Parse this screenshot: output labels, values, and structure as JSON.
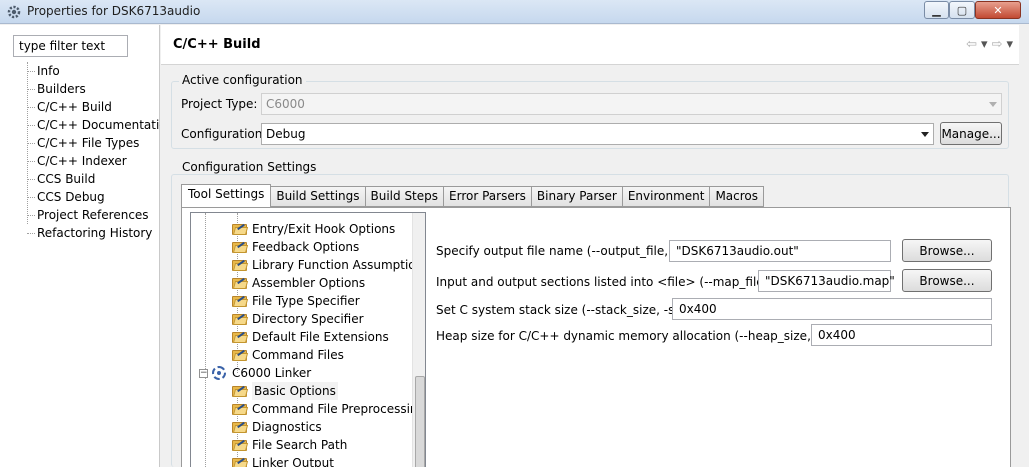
{
  "window": {
    "title": "Properties for DSK6713audio",
    "minimize_label": "▁",
    "maximize_label": "▢",
    "close_label": "✕"
  },
  "filter": {
    "value": "type filter text"
  },
  "nav": {
    "items": [
      {
        "label": "Info"
      },
      {
        "label": "Builders"
      },
      {
        "label": "C/C++ Build"
      },
      {
        "label": "C/C++ Documentation"
      },
      {
        "label": "C/C++ File Types"
      },
      {
        "label": "C/C++ Indexer"
      },
      {
        "label": "CCS Build"
      },
      {
        "label": "CCS Debug"
      },
      {
        "label": "Project References"
      },
      {
        "label": "Refactoring History"
      }
    ]
  },
  "page": {
    "title": "C/C++ Build",
    "back_arrow": "⇦",
    "forward_arrow": "⇨",
    "dropdown_glyph": "▾"
  },
  "active_configuration": {
    "group_label": "Active configuration",
    "project_type_label": "Project Type:",
    "project_type_value": "C6000",
    "configuration_label": "Configuration:",
    "configuration_value": "Debug",
    "manage_button": "Manage..."
  },
  "configuration_settings": {
    "group_label": "Configuration Settings"
  },
  "tabs": [
    {
      "label": "Tool Settings",
      "active": true
    },
    {
      "label": "Build Settings"
    },
    {
      "label": "Build Steps"
    },
    {
      "label": "Error Parsers"
    },
    {
      "label": "Binary Parser"
    },
    {
      "label": "Environment"
    },
    {
      "label": "Macros"
    }
  ],
  "tool_tree": {
    "items": [
      {
        "label": "Entry/Exit Hook Options",
        "kind": "options"
      },
      {
        "label": "Feedback Options",
        "kind": "options"
      },
      {
        "label": "Library Function Assumptions",
        "kind": "options"
      },
      {
        "label": "Assembler Options",
        "kind": "options"
      },
      {
        "label": "File Type Specifier",
        "kind": "options"
      },
      {
        "label": "Directory Specifier",
        "kind": "options"
      },
      {
        "label": "Default File Extensions",
        "kind": "options"
      },
      {
        "label": "Command Files",
        "kind": "options"
      },
      {
        "label": "C6000 Linker",
        "kind": "tool",
        "expander": "−"
      },
      {
        "label": "Basic Options",
        "kind": "options",
        "selected": true
      },
      {
        "label": "Command File Preprocessing",
        "kind": "options"
      },
      {
        "label": "Diagnostics",
        "kind": "options"
      },
      {
        "label": "File Search Path",
        "kind": "options"
      },
      {
        "label": "Linker Output",
        "kind": "options"
      }
    ]
  },
  "settings": {
    "output_file_label": "Specify output file name (--output_file, -o)",
    "output_file_value": "\"DSK6713audio.out\"",
    "map_file_label": "Input and output sections listed into <file> (--map_file, -m)",
    "map_file_value": "\"DSK6713audio.map\"",
    "stack_size_label": "Set C system stack size (--stack_size, -stack)",
    "stack_size_value": "0x400",
    "heap_size_label": "Heap size for C/C++ dynamic memory allocation (--heap_size, -heap)",
    "heap_size_value": "0x400",
    "browse_button": "Browse..."
  }
}
